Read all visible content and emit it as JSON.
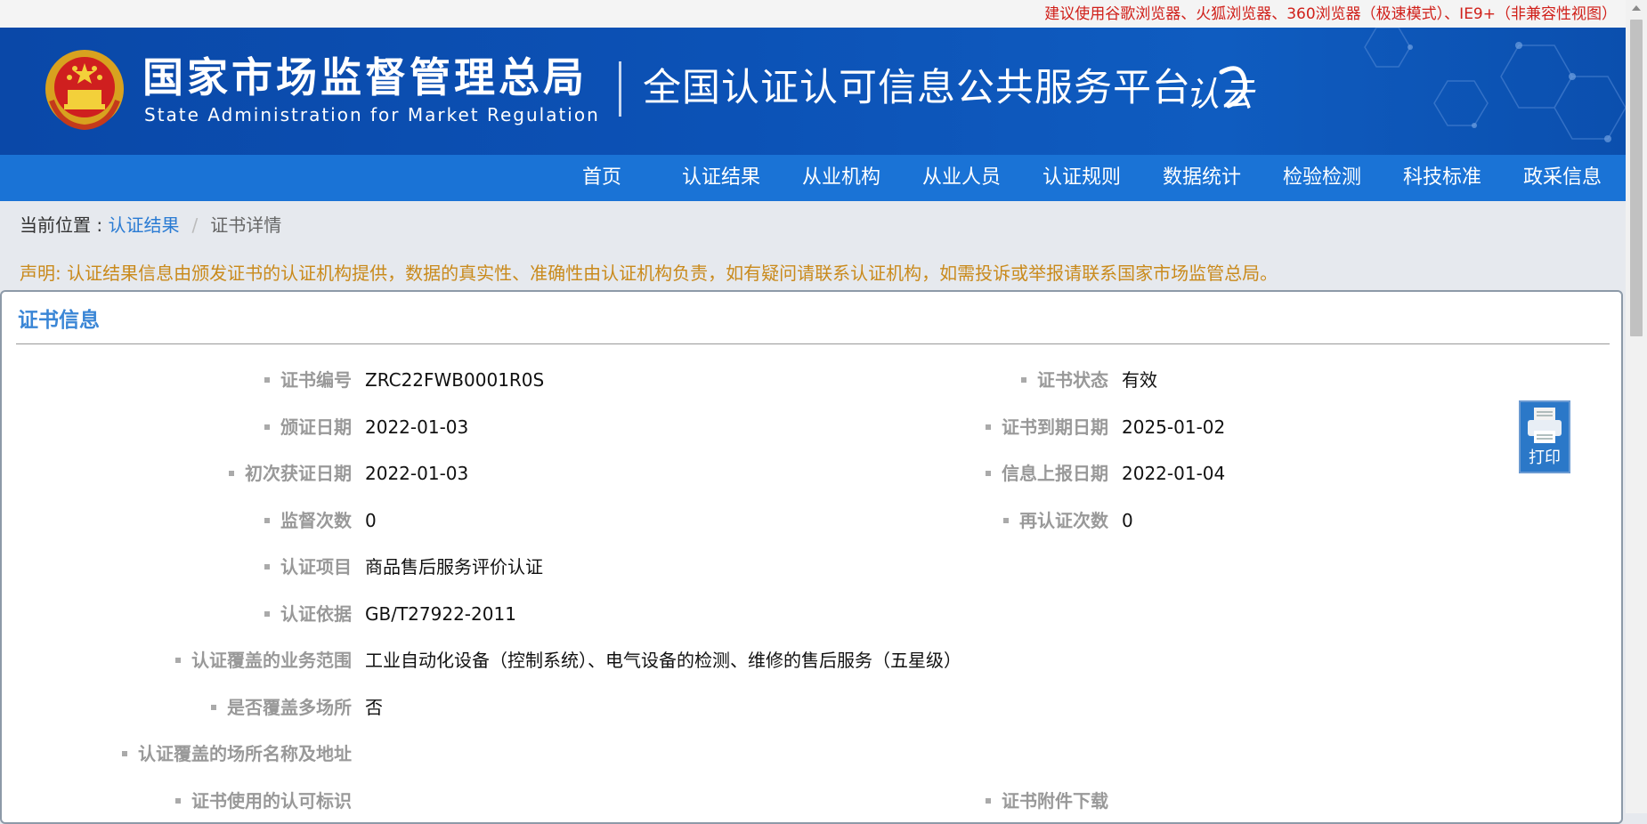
{
  "top_notice": "建议使用谷歌浏览器、火狐浏览器、360浏览器（极速模式）、IE9+（非兼容性视图）",
  "header": {
    "agency_cn": "国家市场监督管理总局",
    "agency_en": "State Administration  for  Market Regulation",
    "platform": "全国认证认可信息公共服务平台",
    "logo_text": "认云"
  },
  "nav": [
    "首页",
    "认证结果",
    "从业机构",
    "从业人员",
    "认证规则",
    "数据统计",
    "检验检测",
    "科技标准",
    "政采信息"
  ],
  "breadcrumb": {
    "prefix": "当前位置 : ",
    "link": "认证结果",
    "separator": "/",
    "current": "证书详情"
  },
  "declaration": "声明: 认证结果信息由颁发证书的认证机构提供，数据的真实性、准确性由认证机构负责，如有疑问请联系认证机构，如需投诉或举报请联系国家市场监管总局。",
  "certificate": {
    "section_title": "证书信息",
    "fields": {
      "cert_no": {
        "label": "证书编号",
        "value": "ZRC22FWB0001R0S"
      },
      "cert_status": {
        "label": "证书状态",
        "value": "有效"
      },
      "issue_date": {
        "label": "颁证日期",
        "value": "2022-01-03"
      },
      "expiry_date": {
        "label": "证书到期日期",
        "value": "2025-01-02"
      },
      "first_cert_date": {
        "label": "初次获证日期",
        "value": "2022-01-03"
      },
      "report_date": {
        "label": "信息上报日期",
        "value": "2022-01-04"
      },
      "supervision_count": {
        "label": "监督次数",
        "value": "0"
      },
      "recert_count": {
        "label": "再认证次数",
        "value": "0"
      },
      "cert_item": {
        "label": "认证项目",
        "value": "商品售后服务评价认证"
      },
      "cert_basis": {
        "label": "认证依据",
        "value": "GB/T27922-2011"
      },
      "business_scope": {
        "label": "认证覆盖的业务范围",
        "value": "工业自动化设备（控制系统）、电气设备的检测、维修的售后服务（五星级）"
      },
      "multi_site": {
        "label": "是否覆盖多场所",
        "value": "否"
      },
      "site_address": {
        "label": "认证覆盖的场所名称及地址",
        "value": ""
      },
      "accreditation_mark": {
        "label": "证书使用的认可标识",
        "value": ""
      },
      "attachment_download": {
        "label": "证书附件下载",
        "value": ""
      }
    }
  },
  "print_button": "打印"
}
